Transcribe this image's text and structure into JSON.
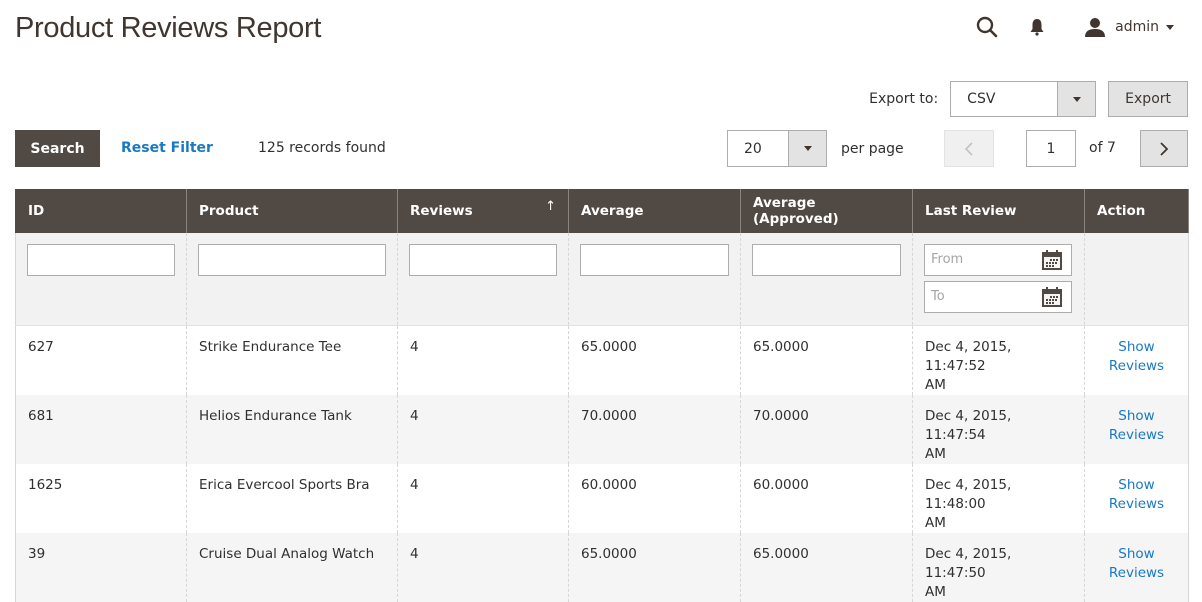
{
  "header": {
    "title": "Product Reviews Report",
    "user": "admin",
    "icons": {
      "search": "search-icon",
      "notifications": "bell-icon",
      "user": "user-icon"
    }
  },
  "export": {
    "label": "Export to:",
    "format": "CSV",
    "button": "Export"
  },
  "toolbar": {
    "search_label": "Search",
    "reset_label": "Reset Filter",
    "records_found": "125 records found",
    "per_page_value": "20",
    "per_page_label": "per page",
    "current_page": "1",
    "total_pages_label": "of 7"
  },
  "grid": {
    "columns": [
      "ID",
      "Product",
      "Reviews",
      "Average",
      "Average (Approved)",
      "Last Review",
      "Action"
    ],
    "sorted_column": "Reviews",
    "sort_direction": "ascending",
    "date_filter": {
      "from_placeholder": "From",
      "to_placeholder": "To"
    },
    "rows": [
      {
        "id": "627",
        "product": "Strike Endurance Tee",
        "reviews": "4",
        "average": "65.0000",
        "average_approved": "65.0000",
        "last_review_line1": "Dec 4, 2015, 11:47:52",
        "last_review_line2": "AM",
        "action_line1": "Show",
        "action_line2": "Reviews"
      },
      {
        "id": "681",
        "product": "Helios Endurance Tank",
        "reviews": "4",
        "average": "70.0000",
        "average_approved": "70.0000",
        "last_review_line1": "Dec 4, 2015, 11:47:54",
        "last_review_line2": "AM",
        "action_line1": "Show",
        "action_line2": "Reviews"
      },
      {
        "id": "1625",
        "product": "Erica Evercool Sports Bra",
        "reviews": "4",
        "average": "60.0000",
        "average_approved": "60.0000",
        "last_review_line1": "Dec 4, 2015, 11:48:00",
        "last_review_line2": "AM",
        "action_line1": "Show",
        "action_line2": "Reviews"
      },
      {
        "id": "39",
        "product": "Cruise Dual Analog Watch",
        "reviews": "4",
        "average": "65.0000",
        "average_approved": "65.0000",
        "last_review_line1": "Dec 4, 2015, 11:47:50",
        "last_review_line2": "AM",
        "action_line1": "Show",
        "action_line2": "Reviews"
      }
    ]
  },
  "colors": {
    "header_bg": "#514943",
    "link": "#1979c3",
    "title": "#41362f"
  }
}
